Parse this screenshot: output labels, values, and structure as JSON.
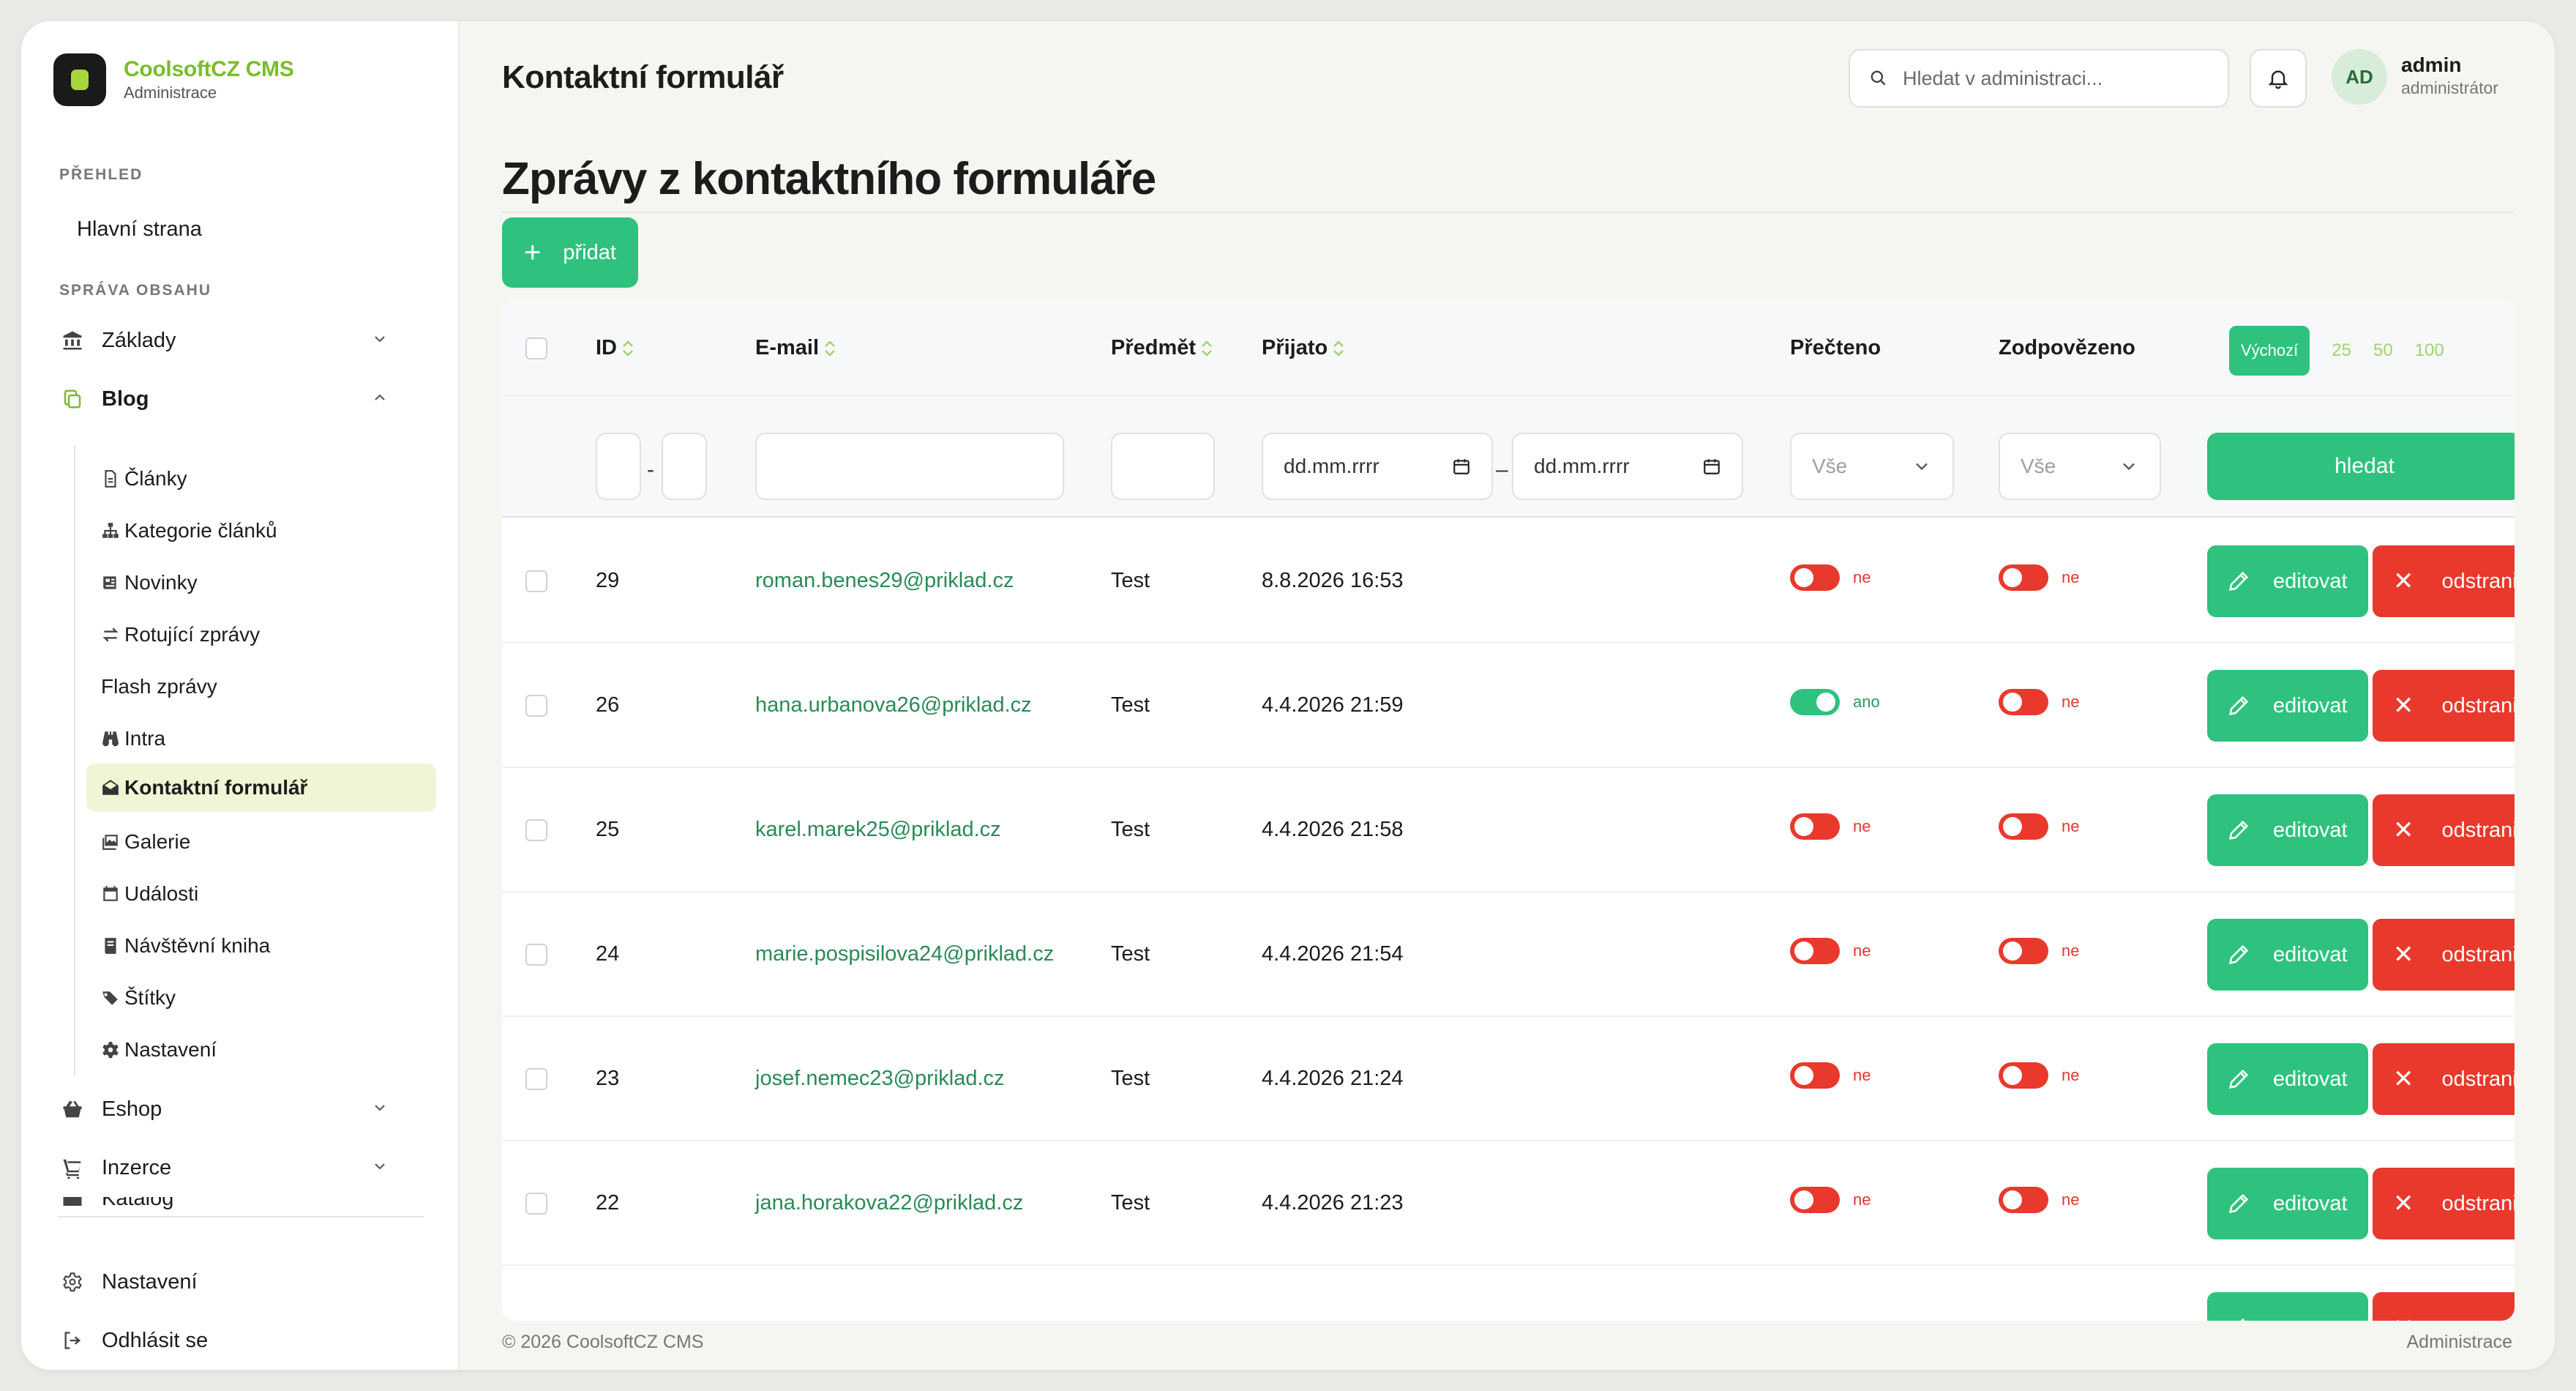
{
  "brand": {
    "name": "CoolsoftCZ CMS",
    "sub": "Administrace"
  },
  "sidebar": {
    "overview_heading": "PŘEHLED",
    "home": "Hlavní strana",
    "content_heading": "SPRÁVA OBSAHU",
    "groups": {
      "zaklady": "Základy",
      "blog": "Blog",
      "eshop": "Eshop",
      "inzerce": "Inzerce",
      "katalog": "Katalog"
    },
    "blog_items": [
      "Články",
      "Kategorie článků",
      "Novinky",
      "Rotující zprávy",
      "Flash zprávy",
      "Intra",
      "Kontaktní formulář",
      "Galerie",
      "Události",
      "Návštěvní kniha",
      "Štítky",
      "Nastavení"
    ],
    "settings": "Nastavení",
    "logout": "Odhlásit se"
  },
  "header": {
    "title": "Kontaktní formulář",
    "search_placeholder": "Hledat v administraci...",
    "avatar": "AD",
    "user_name": "admin",
    "user_role": "administrátor"
  },
  "main": {
    "section_title": "Zprávy z kontaktního formuláře",
    "add_label": "přidat"
  },
  "table": {
    "columns": {
      "id": "ID",
      "email": "E-mail",
      "subject": "Předmět",
      "received": "Přijato",
      "read": "Přečteno",
      "answered": "Zodpovězeno"
    },
    "pager": {
      "active": "Výchozí",
      "options": [
        "25",
        "50",
        "100"
      ]
    },
    "filters": {
      "date_placeholder": "dd.mm.rrrr",
      "select_all": "Vše",
      "search_label": "hledat"
    },
    "edit_label": "editovat",
    "delete_label": "odstranit",
    "yes": "ano",
    "no": "ne",
    "rows": [
      {
        "id": "29",
        "email": "roman.benes29@priklad.cz",
        "subject": "Test",
        "received": "8.8.2026 16:53",
        "read": false,
        "answered": false
      },
      {
        "id": "26",
        "email": "hana.urbanova26@priklad.cz",
        "subject": "Test",
        "received": "4.4.2026 21:59",
        "read": true,
        "answered": false
      },
      {
        "id": "25",
        "email": "karel.marek25@priklad.cz",
        "subject": "Test",
        "received": "4.4.2026 21:58",
        "read": false,
        "answered": false
      },
      {
        "id": "24",
        "email": "marie.pospisilova24@priklad.cz",
        "subject": "Test",
        "received": "4.4.2026 21:54",
        "read": false,
        "answered": false
      },
      {
        "id": "23",
        "email": "josef.nemec23@priklad.cz",
        "subject": "Test",
        "received": "4.4.2026 21:24",
        "read": false,
        "answered": false
      },
      {
        "id": "22",
        "email": "jana.horakova22@priklad.cz",
        "subject": "Test",
        "received": "4.4.2026 21:23",
        "read": false,
        "answered": false
      }
    ]
  },
  "footer": {
    "copyright": "© 2026 CoolsoftCZ CMS",
    "right": "Administrace"
  },
  "colors": {
    "accent": "#2ec27e",
    "danger": "#e8392c",
    "brand": "#7bbc2a",
    "active_nav": "#eef6d6"
  }
}
